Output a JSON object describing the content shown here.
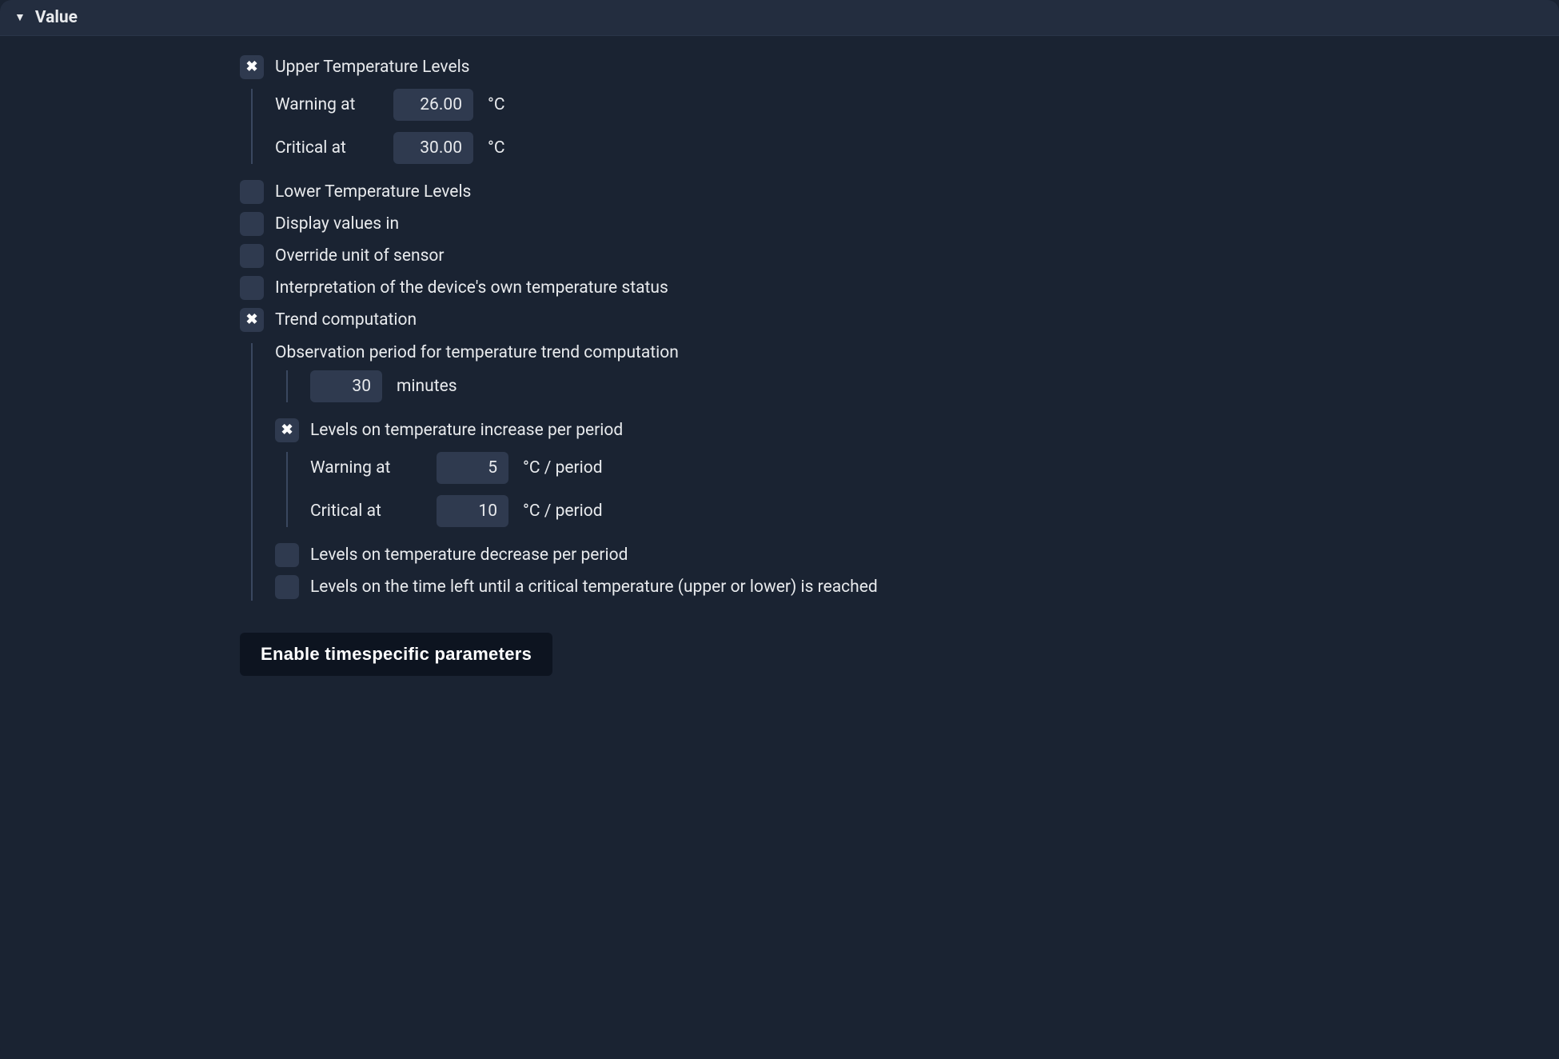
{
  "header": {
    "title": "Value"
  },
  "upper": {
    "label": "Upper Temperature Levels",
    "warning_label": "Warning at",
    "warning_value": "26.00",
    "warning_unit": "°C",
    "critical_label": "Critical at",
    "critical_value": "30.00",
    "critical_unit": "°C"
  },
  "options": {
    "lower_levels": "Lower Temperature Levels",
    "display_values_in": "Display values in",
    "override_unit": "Override unit of sensor",
    "interpretation": "Interpretation of the device's own temperature status"
  },
  "trend": {
    "label": "Trend computation",
    "observation_label": "Observation period for temperature trend computation",
    "observation_value": "30",
    "observation_unit": "minutes",
    "increase": {
      "label": "Levels on temperature increase per period",
      "warning_label": "Warning at",
      "warning_value": "5",
      "warning_unit": "°C / period",
      "critical_label": "Critical at",
      "critical_value": "10",
      "critical_unit": "°C / period"
    },
    "decrease_label": "Levels on temperature decrease per period",
    "timeleft_label": "Levels on the time left until a critical temperature (upper or lower) is reached"
  },
  "button": {
    "enable_timespecific": "Enable timespecific parameters"
  }
}
